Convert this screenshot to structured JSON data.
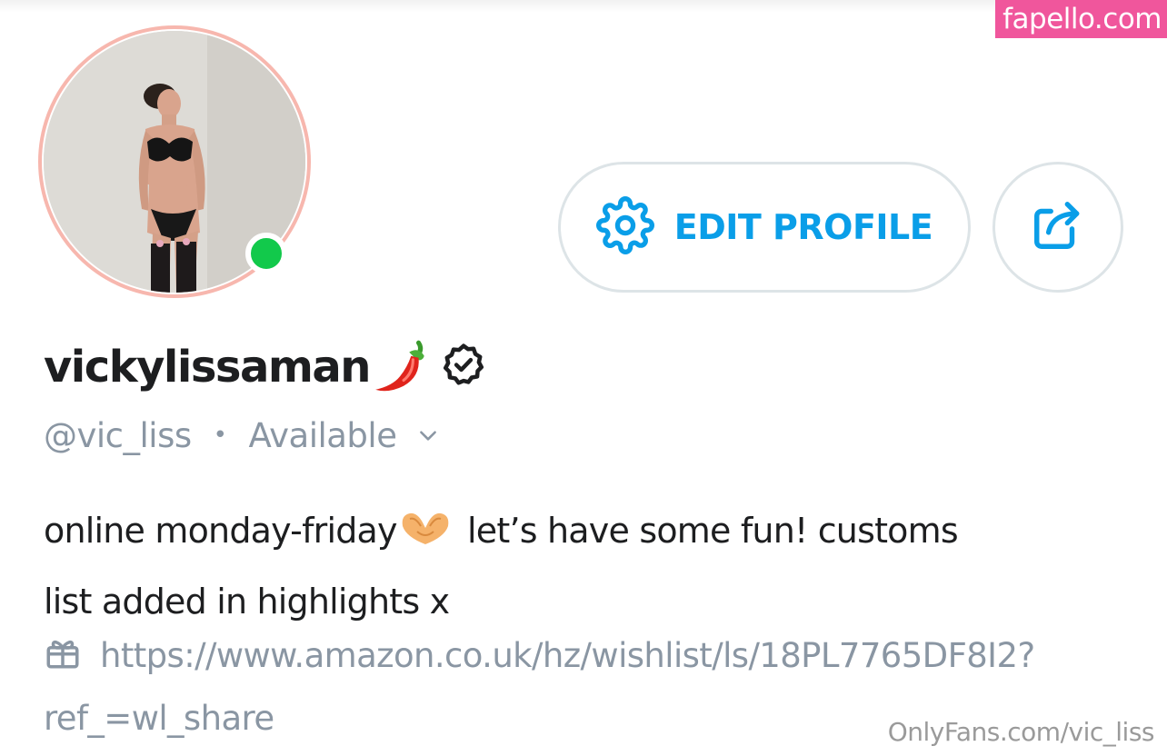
{
  "watermark": {
    "text": "fapello.com",
    "color": "#f0569c"
  },
  "profile": {
    "avatar_alt": "profile photo",
    "online": true,
    "display_name": "vickylissaman",
    "name_emoji": "hot-pepper",
    "verified": true,
    "handle": "@vic_liss",
    "separator": "•",
    "status": "Available",
    "bio_line1": "online monday-friday",
    "bio_emoji": "heart-hands",
    "bio_line1_rest": " let’s have some fun! customs",
    "bio_line2": "list added in highlights x",
    "wishlist_url": "https://www.amazon.co.uk/hz/wishlist/ls/18PL7765DF8I2?ref_=wl_share"
  },
  "actions": {
    "edit_profile_label": "EDIT PROFILE",
    "share_icon": "share-icon",
    "settings_icon": "gear-icon"
  },
  "footer": {
    "text": "OnlyFans.com/vic_liss"
  },
  "colors": {
    "accent": "#0a9ee8",
    "muted": "#8a96a3",
    "text": "#1d1e20",
    "online": "#12c94b",
    "avatar_ring": "#f7b7ae",
    "button_border": "#dde4e7"
  }
}
